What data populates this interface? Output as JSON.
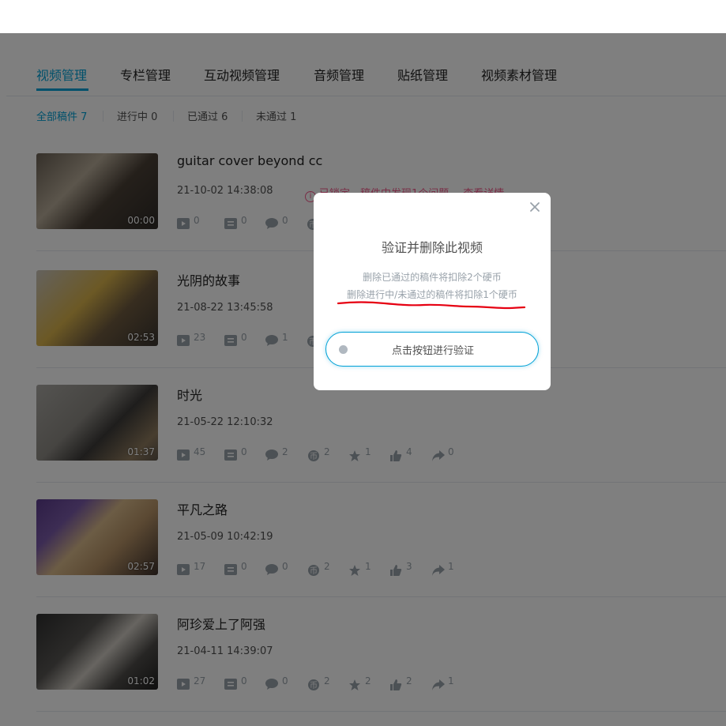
{
  "tabs": [
    {
      "label": "视频管理",
      "active": true
    },
    {
      "label": "专栏管理"
    },
    {
      "label": "互动视频管理"
    },
    {
      "label": "音频管理"
    },
    {
      "label": "贴纸管理"
    },
    {
      "label": "视频素材管理"
    }
  ],
  "filters": [
    {
      "label": "全部稿件 7",
      "active": true
    },
    {
      "label": "进行中 0"
    },
    {
      "label": "已通过 6"
    },
    {
      "label": "未通过 1"
    }
  ],
  "videos": [
    {
      "title": "guitar cover beyond cc",
      "time": "21-10-02 14:38:08",
      "duration": "00:00",
      "warning": "已锁定，稿件中发现1个问题",
      "warning_link": "查看详情",
      "stats": {
        "play": "0",
        "danmaku": "0",
        "comment": "0"
      }
    },
    {
      "title": "光阴的故事",
      "time": "21-08-22 13:45:58",
      "duration": "02:53",
      "stats": {
        "play": "23",
        "danmaku": "0",
        "comment": "1"
      }
    },
    {
      "title": "时光",
      "time": "21-05-22 12:10:32",
      "duration": "01:37",
      "stats": {
        "play": "45",
        "danmaku": "0",
        "comment": "2",
        "coin": "2",
        "fav": "1",
        "like": "4",
        "share": "0"
      }
    },
    {
      "title": "平凡之路",
      "time": "21-05-09 10:42:19",
      "duration": "02:57",
      "stats": {
        "play": "17",
        "danmaku": "0",
        "comment": "0",
        "coin": "2",
        "fav": "1",
        "like": "3",
        "share": "1"
      }
    },
    {
      "title": "阿珍爱上了阿强",
      "time": "21-04-11 14:39:07",
      "duration": "01:02",
      "stats": {
        "play": "27",
        "danmaku": "0",
        "comment": "0",
        "coin": "2",
        "fav": "2",
        "like": "2",
        "share": "1"
      }
    }
  ],
  "modal": {
    "title": "验证并删除此视频",
    "line1": "删除已通过的稿件将扣除2个硬币",
    "line2": "删除进行中/未通过的稿件将扣除1个硬币",
    "verify_label": "点击按钮进行验证"
  },
  "colors": {
    "accent": "#00a1d6",
    "warning": "#f45a8d",
    "annotation": "#e60012"
  },
  "icons": [
    "play-icon",
    "danmaku-icon",
    "comment-icon",
    "coin-icon",
    "favorite-icon",
    "like-icon",
    "share-icon",
    "close-icon",
    "info-icon"
  ]
}
